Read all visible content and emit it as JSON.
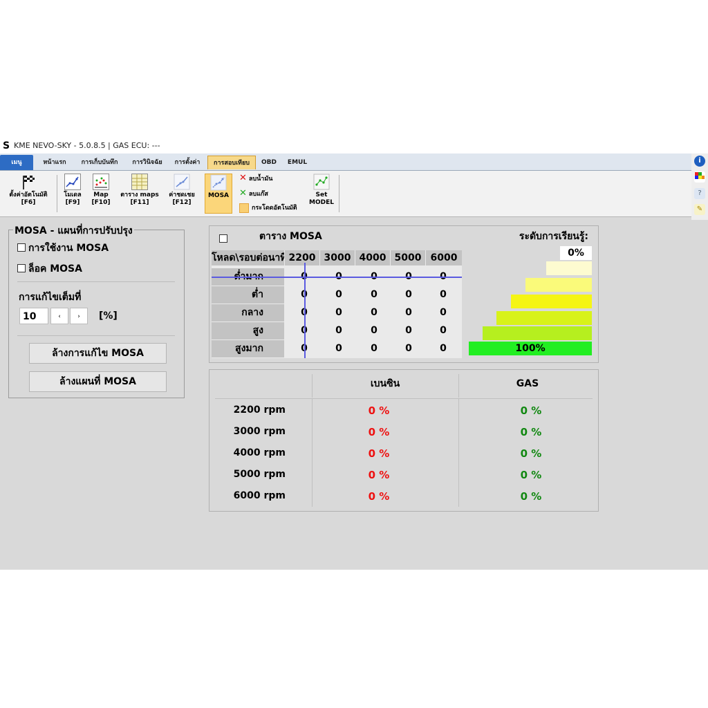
{
  "app": {
    "logo": "S",
    "title": "KME NEVO-SKY - 5.0.8.5 | GAS ECU: ---"
  },
  "tabs": [
    {
      "label": "เมนู"
    },
    {
      "label": "หน้าแรก"
    },
    {
      "label": "การเก็บบันทึก"
    },
    {
      "label": "การวินิจฉัย"
    },
    {
      "label": "การตั้งค่า"
    },
    {
      "label": "การสอบเทียบ"
    },
    {
      "label": "OBD"
    },
    {
      "label": "EMUL"
    }
  ],
  "ribbon": {
    "auto_settings": {
      "label": "ตั้งค่าอัตโนมัติ",
      "key": "[F6]"
    },
    "model": {
      "label": "โมเดล",
      "key": "[F9]"
    },
    "map": {
      "label": "Map",
      "key": "[F10]"
    },
    "maps_table": {
      "label": "ตาราง maps",
      "key": "[F11]"
    },
    "compensation": {
      "label": "ค่าชดเชย",
      "key": "[F12]"
    },
    "mosa": {
      "label": "MOSA"
    },
    "delete_petrol": "ลบน้ำมัน",
    "delete_gas": "ลบแก๊ส",
    "auto_jump": "กระโดดอัตโนมัติ",
    "set_model": {
      "line1": "Set",
      "line2": "MODEL"
    }
  },
  "left_panel": {
    "title": "MOSA - แผนที่การปรับปรุง",
    "use_mosa": "การใช้งาน MOSA",
    "lock_mosa": "ล็อค MOSA",
    "max_correction_label": "การแก้ไขเต็มที่",
    "max_correction_value": "10",
    "unit": "[%]",
    "clear_correction": "ล้างการแก้ไข MOSA",
    "clear_map": "ล้างแผนที่ MOSA"
  },
  "mosa_table": {
    "title": "ตาราง MOSA",
    "corner": "โหลด\\รอบต่อนาที",
    "rpm": [
      "2200",
      "3000",
      "4000",
      "5000",
      "6000"
    ],
    "loads": [
      "ต่ำมาก",
      "ต่ำ",
      "กลาง",
      "สูง",
      "สูงมาก"
    ],
    "values": [
      [
        "0",
        "0",
        "0",
        "0",
        "0"
      ],
      [
        "0",
        "0",
        "0",
        "0",
        "0"
      ],
      [
        "0",
        "0",
        "0",
        "0",
        "0"
      ],
      [
        "0",
        "0",
        "0",
        "0",
        "0"
      ],
      [
        "0",
        "0",
        "0",
        "0",
        "0"
      ]
    ]
  },
  "learning": {
    "label": "ระดับการเรียนรู้:",
    "value": "0%",
    "full": "100%",
    "level_colors": [
      "#ffffff",
      "#fdfbd0",
      "#fafa7a",
      "#f5f514",
      "#d8f21a",
      "#b6ef1f",
      "#22ee22"
    ]
  },
  "summary": {
    "col_petrol": "เบนซิน",
    "col_gas": "GAS",
    "rows": [
      {
        "rpm": "2200 rpm",
        "petrol": "0 %",
        "gas": "0 %"
      },
      {
        "rpm": "3000 rpm",
        "petrol": "0 %",
        "gas": "0 %"
      },
      {
        "rpm": "4000 rpm",
        "petrol": "0 %",
        "gas": "0 %"
      },
      {
        "rpm": "5000 rpm",
        "petrol": "0 %",
        "gas": "0 %"
      },
      {
        "rpm": "6000 rpm",
        "petrol": "0 %",
        "gas": "0 %"
      }
    ],
    "petrol_color": "#ee1111",
    "gas_color": "#118811"
  }
}
